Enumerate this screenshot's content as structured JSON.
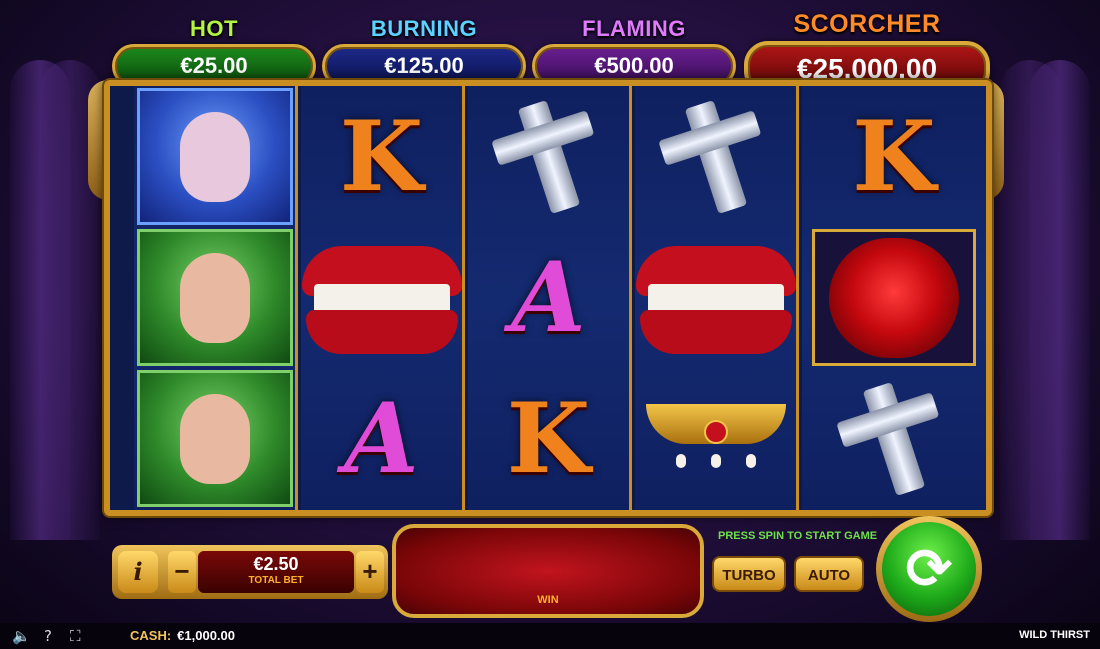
{
  "jackpots": [
    {
      "label": "HOT",
      "value": "€25.00"
    },
    {
      "label": "BURNING",
      "value": "€125.00"
    },
    {
      "label": "FLAMING",
      "value": "€500.00"
    },
    {
      "label": "SCORCHER",
      "value": "€25,000.00"
    }
  ],
  "reels": [
    [
      "vampire-woman",
      "hero-man",
      "hero-man"
    ],
    [
      "K",
      "vampire-lips",
      "A"
    ],
    [
      "silver-cross",
      "A",
      "K"
    ],
    [
      "silver-cross",
      "vampire-lips",
      "gold-necklace"
    ],
    [
      "K",
      "red-rose",
      "silver-cross"
    ]
  ],
  "bet": {
    "info_label": "i",
    "minus_label": "−",
    "plus_label": "+",
    "amount": "€2.50",
    "label": "TOTAL BET"
  },
  "win": {
    "label": "WIN"
  },
  "controls": {
    "press_spin": "PRESS SPIN TO START GAME",
    "turbo": "TURBO",
    "auto": "AUTO",
    "spin_glyph": "⟳"
  },
  "footer": {
    "cash_label": "CASH:",
    "cash_value": "€1,000.00",
    "game_name": "WILD THIRST",
    "sound_icon": "🔈",
    "help_icon": "?",
    "fullscreen_icon": "⛶"
  },
  "colors": {
    "hot": "#1c8a1c",
    "burning": "#1d2a8a",
    "flaming": "#6a1f90",
    "scorcher": "#b01616",
    "frame_gold": "#c98f22",
    "spin_green": "#1eaa1a"
  }
}
